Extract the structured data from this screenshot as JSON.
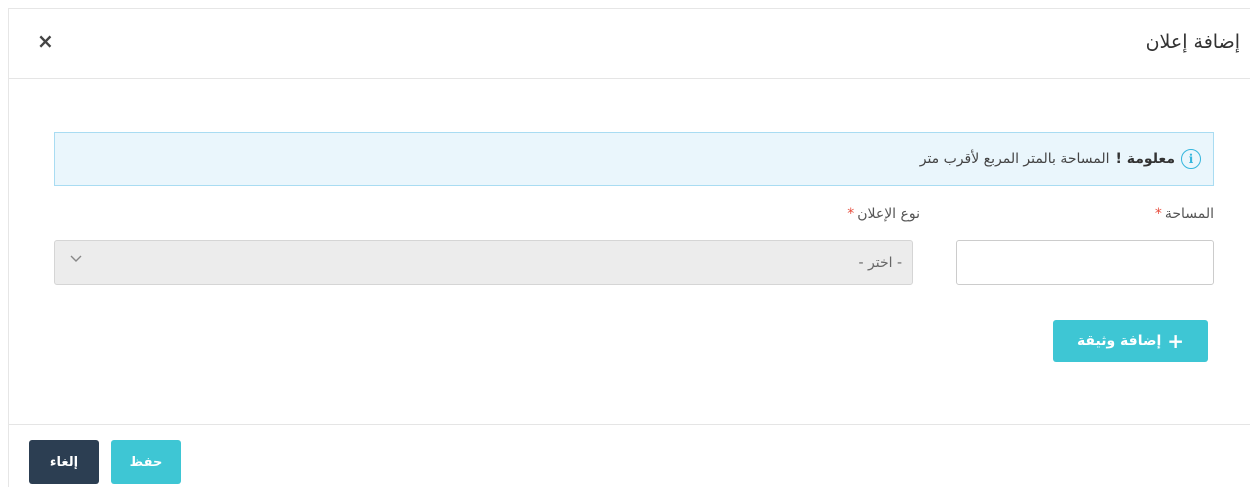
{
  "modal": {
    "title": "إضافة إعلان",
    "close_symbol": "×"
  },
  "alert": {
    "icon": "info-icon",
    "icon_glyph": "i",
    "strong": "معلومة !",
    "message": "المساحة بالمتر المربع لأقرب متر"
  },
  "form": {
    "area_label": "المساحة",
    "area_value": "",
    "ad_type_label": "نوع الإعلان",
    "ad_type_selected": "- اختر -",
    "required_mark": "*"
  },
  "buttons": {
    "add_document": "إضافة وثيقة",
    "add_document_plus": "+",
    "save": "حفظ",
    "cancel": "إلغاء"
  },
  "colors": {
    "accent": "#3ec6d4",
    "dark": "#2c3e52",
    "alert_bg": "#eaf6fc",
    "required": "#e74c3c"
  }
}
